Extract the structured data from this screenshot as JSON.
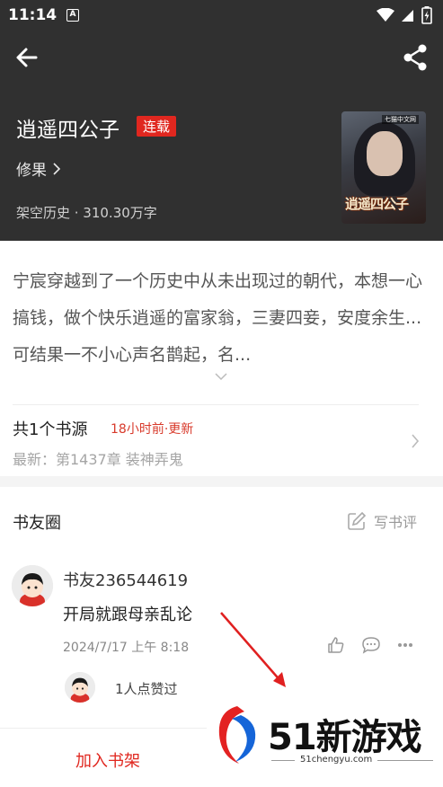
{
  "status_bar": {
    "time": "11:14",
    "notification_letter": "A"
  },
  "book": {
    "title": "逍遥四公子",
    "status_badge": "连载",
    "author": "修果",
    "meta": "架空历史 · 310.30万字",
    "cover_title": "逍遥四公子",
    "cover_logo": "七猫中文网"
  },
  "description": {
    "text": "宁宸穿越到了一个历史中从未出现过的朝代，本想一心搞钱，做个快乐逍遥的富家翁，三妻四妾，安度余生...可结果一不小心声名鹊起，名..."
  },
  "source": {
    "title": "共1个书源",
    "updated": "18小时前·更新",
    "latest": "最新：第1437章 装神弄鬼"
  },
  "book_friends": {
    "title": "书友圈",
    "write_review": "写书评",
    "comment": {
      "user": "书友236544619",
      "text": "开局就跟母亲乱论",
      "date": "2024/7/17 上午 8:18",
      "liked_by": "1人点赞过"
    }
  },
  "bottom_bar": {
    "add_to_shelf": "加入书架"
  },
  "watermark": {
    "brand": "51新游戏",
    "url": "51chengyu.com"
  },
  "colors": {
    "header_bg": "#303030",
    "accent_red": "#e0271f",
    "update_red": "#d83a2b"
  }
}
